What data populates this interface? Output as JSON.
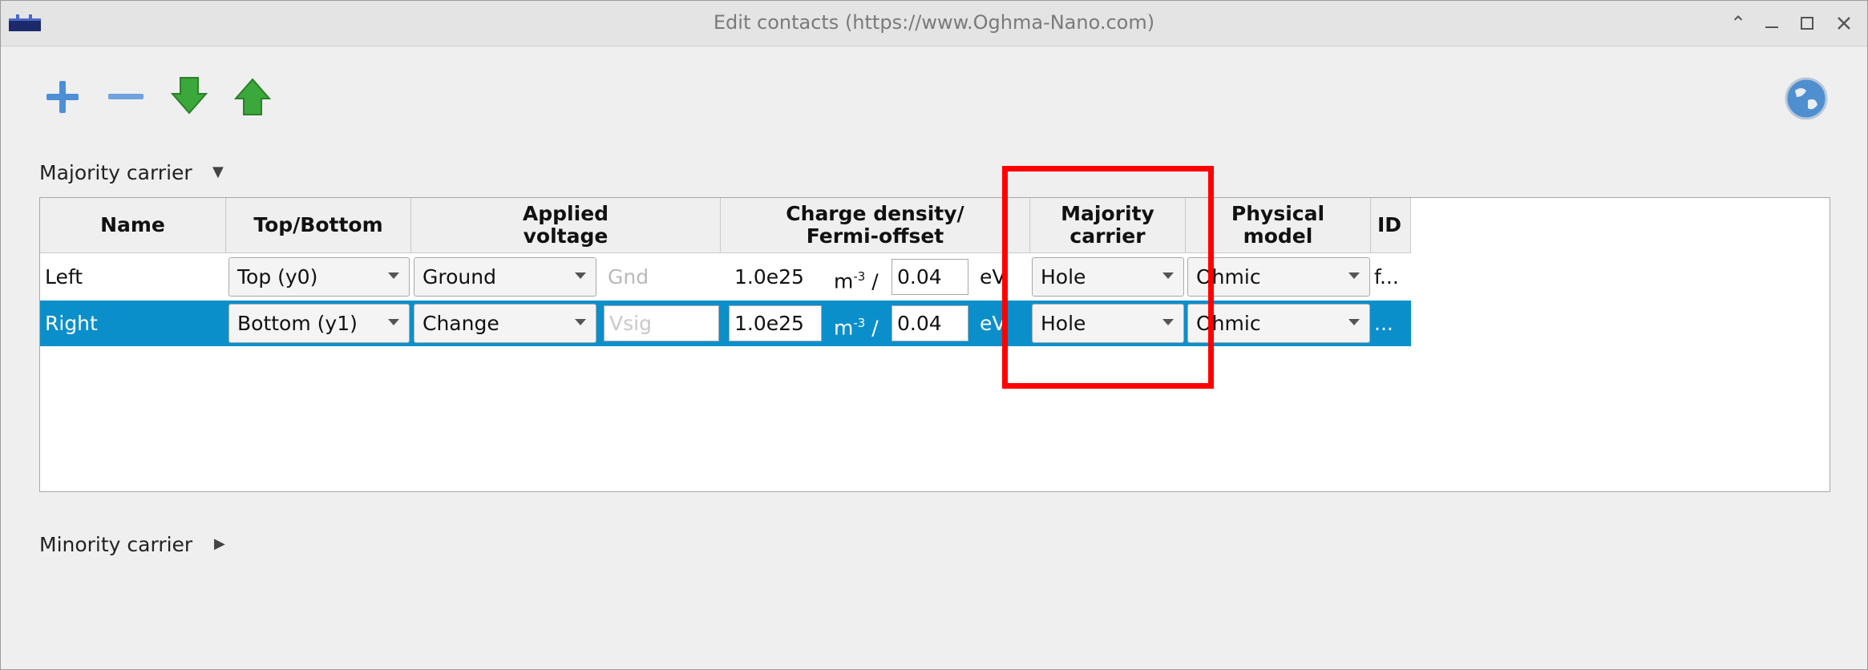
{
  "window": {
    "title": "Edit contacts (https://www.Oghma-Nano.com)"
  },
  "toolbar": {
    "add_icon": "plus-icon",
    "remove_icon": "minus-icon",
    "down_icon": "arrow-down-icon",
    "up_icon": "arrow-up-icon",
    "help_icon": "globe-icon"
  },
  "sections": {
    "majority": "Majority carrier",
    "minority": "Minority carrier"
  },
  "columns": {
    "name": "Name",
    "top_bottom": "Top/Bottom",
    "applied_voltage": "Applied\nvoltage",
    "charge_density": "Charge density/\nFermi-offset",
    "majority_carrier": "Majority\ncarrier",
    "physical_model": "Physical\nmodel",
    "id": "ID"
  },
  "rows": [
    {
      "name": "Left",
      "position": "Top (y0)",
      "voltage_mode": "Ground",
      "voltage_value": "Gnd",
      "charge_density": "1.0e25",
      "density_unit": "m",
      "density_exp": "-3",
      "separator": "/",
      "fermi_offset": "0.04",
      "fermi_unit": "eV",
      "majority_carrier": "Hole",
      "physical_model": "Ohmic",
      "id": "f..."
    },
    {
      "name": "Right",
      "position": "Bottom (y1)",
      "voltage_mode": "Change",
      "voltage_value": "Vsig",
      "charge_density": "1.0e25",
      "density_unit": "m",
      "density_exp": "-3",
      "separator": "/",
      "fermi_offset": "0.04",
      "fermi_unit": "eV",
      "majority_carrier": "Hole",
      "physical_model": "Ohmic",
      "id": "..."
    }
  ],
  "colors": {
    "selection": "#0b8fcb",
    "highlight": "#ff0000",
    "arrow_green": "#3aa83a",
    "icon_blue": "#4d8fd6"
  }
}
